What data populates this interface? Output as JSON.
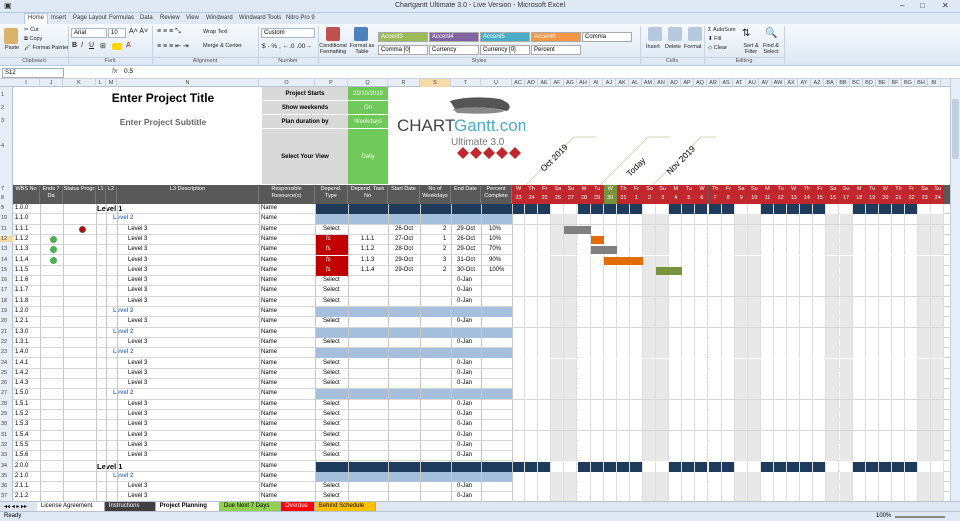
{
  "window": {
    "title": "Chartgantt Ultimate 3.0 - Live Version - Microsoft Excel"
  },
  "ribbon_tabs": [
    "Home",
    "Insert",
    "Page Layout",
    "Formulas",
    "Data",
    "Review",
    "View",
    "Windward",
    "Windward Tools",
    "Nitro Pro 9"
  ],
  "ribbon": {
    "clipboard": {
      "paste": "Paste",
      "cut": "Cut",
      "copy": "Copy",
      "format_painter": "Format Painter",
      "group": "Clipboard"
    },
    "font": {
      "name": "Arial",
      "size": "10",
      "group": "Font"
    },
    "alignment": {
      "wrap": "Wrap Text",
      "merge": "Merge & Center",
      "group": "Alignment"
    },
    "number": {
      "format": "Custom",
      "group": "Number"
    },
    "styles": {
      "cond": "Conditional Formatting",
      "table": "Format as Table",
      "group": "Styles",
      "items": [
        {
          "label": "Accent3",
          "bg": "#9bbb59",
          "fg": "#ffffff"
        },
        {
          "label": "Accent4",
          "bg": "#8064a2",
          "fg": "#ffffff"
        },
        {
          "label": "Accent5",
          "bg": "#4bacc6",
          "fg": "#ffffff"
        },
        {
          "label": "Accent6",
          "bg": "#f79646",
          "fg": "#ffffff"
        },
        {
          "label": "Comma",
          "bg": "#ffffff",
          "fg": "#000000"
        },
        {
          "label": "Comma [0]",
          "bg": "#ffffff",
          "fg": "#000000"
        },
        {
          "label": "Currency",
          "bg": "#ffffff",
          "fg": "#000000"
        },
        {
          "label": "Currency [0]",
          "bg": "#ffffff",
          "fg": "#000000"
        },
        {
          "label": "Percent",
          "bg": "#ffffff",
          "fg": "#000000"
        }
      ]
    },
    "cells": {
      "insert": "Insert",
      "delete": "Delete",
      "format": "Format",
      "group": "Cells"
    },
    "editing": {
      "autosum": "AutoSum",
      "fill": "Fill",
      "clear": "Clear",
      "sort": "Sort & Filter",
      "find": "Find & Select",
      "group": "Editing"
    }
  },
  "formula_bar": {
    "name_box": "S12",
    "fx": "fx",
    "value": "0.5"
  },
  "col_letters": [
    "I",
    "J",
    "K",
    "L",
    "M",
    "N",
    "O",
    "P",
    "Q",
    "R",
    "S",
    "T",
    "U",
    "AC",
    "AD",
    "AE",
    "AF",
    "AG",
    "AH",
    "AI",
    "AJ",
    "AK",
    "AL",
    "AM",
    "AN",
    "AO",
    "AP",
    "AQ",
    "AR",
    "AS",
    "AT",
    "AU",
    "AV",
    "AW",
    "AX",
    "AY",
    "AZ",
    "BA",
    "BB",
    "BC",
    "BD",
    "BE",
    "BF",
    "BG",
    "BH",
    "BI"
  ],
  "row_numbers": [
    "1",
    "2",
    "3",
    "4",
    "7",
    "8",
    "9",
    "10",
    "11",
    "12",
    "13",
    "14",
    "15",
    "16",
    "17",
    "18",
    "19",
    "20",
    "21",
    "22",
    "23",
    "24",
    "25",
    "26",
    "27",
    "28",
    "29",
    "30",
    "31",
    "32",
    "33",
    "34",
    "35",
    "36",
    "37"
  ],
  "project": {
    "title": "Enter Project Title",
    "subtitle": "Enter Project Subtitle"
  },
  "settings": [
    {
      "label": "Project Starts",
      "value": "23/10/2019"
    },
    {
      "label": "Show weekends",
      "value": "On"
    },
    {
      "label": "Plan duration by",
      "value": "Weekdays"
    },
    {
      "label": "Select Your View",
      "value": "Daily"
    }
  ],
  "logo": {
    "brand1": "CHART",
    "brand2": "Gantt",
    "brand3": ".com",
    "sub": "Ultimate 3.0"
  },
  "month_labels": [
    "Oct 2019",
    "Today",
    "Nov 2019"
  ],
  "table_headers": {
    "wbs": "WBS No",
    "ends": "Ends 7 Da",
    "status": "Status Progr",
    "l1": "L1",
    "l2": "L2",
    "l3": "L3 Description",
    "resp": "Responsible Resource(s)",
    "dtype": "Depend. Type",
    "dtask": "Depend. Task No",
    "start": "Start Date",
    "days": "No of Weekdays",
    "end": "End Date",
    "pct": "Percent Complete"
  },
  "day_letters": [
    "W",
    "Th",
    "Fr",
    "Sa",
    "Su",
    "M",
    "Tu",
    "W",
    "Th",
    "Fr",
    "Sa",
    "Su",
    "M",
    "Tu",
    "W",
    "Th",
    "Fr",
    "Sa",
    "Su",
    "M",
    "Tu",
    "W",
    "Th",
    "Fr",
    "Sa",
    "Su",
    "M",
    "Tu",
    "W",
    "Th",
    "Fr",
    "Sa",
    "Su"
  ],
  "day_numbers": [
    "23",
    "24",
    "25",
    "26",
    "27",
    "28",
    "29",
    "30",
    "31",
    "1",
    "2",
    "3",
    "4",
    "5",
    "6",
    "7",
    "8",
    "9",
    "10",
    "11",
    "12",
    "13",
    "14",
    "15",
    "16",
    "17",
    "18",
    "19",
    "20",
    "21",
    "22",
    "23",
    "24"
  ],
  "rows": [
    {
      "wbs": "1.0.0",
      "l1": "Level 1",
      "resp": "Name",
      "type": "L1"
    },
    {
      "wbs": "1.1.0",
      "l2": "Level 2",
      "resp": "Name",
      "type": "L2"
    },
    {
      "wbs": "1.1.1",
      "l3": "Level 3",
      "resp": "Name",
      "dtype": "Select",
      "start": "26-Oct",
      "days": "2",
      "end": "29-Oct",
      "pct": "10%",
      "status": "red"
    },
    {
      "wbs": "1.1.2",
      "l3": "Level 3",
      "resp": "Name",
      "dtype": "fs",
      "dtask": "1.1.1",
      "start": "27-Oct",
      "days": "1",
      "end": "26-Oct",
      "pct": "10%",
      "ends": "ok"
    },
    {
      "wbs": "1.1.3",
      "l3": "Level 3",
      "resp": "Name",
      "dtype": "fs",
      "dtask": "1.1.2",
      "start": "28-Oct",
      "days": "2",
      "end": "29-Oct",
      "pct": "70%",
      "ends": "ok"
    },
    {
      "wbs": "1.1.4",
      "l3": "Level 3",
      "resp": "Name",
      "dtype": "fs",
      "dtask": "1.1.3",
      "start": "29-Oct",
      "days": "3",
      "end": "31-Oct",
      "pct": "90%",
      "ends": "ok"
    },
    {
      "wbs": "1.1.5",
      "l3": "Level 3",
      "resp": "Name",
      "dtype": "fs",
      "dtask": "1.1.4",
      "start": "29-Oct",
      "days": "2",
      "end": "30-Oct",
      "pct": "100%"
    },
    {
      "wbs": "1.1.6",
      "l3": "Level 3",
      "resp": "Name",
      "dtype": "Select",
      "end": "0-Jan"
    },
    {
      "wbs": "1.1.7",
      "l3": "Level 3",
      "resp": "Name",
      "dtype": "Select",
      "end": "0-Jan"
    },
    {
      "wbs": "1.1.8",
      "l3": "Level 3",
      "resp": "Name",
      "dtype": "Select",
      "end": "0-Jan"
    },
    {
      "wbs": "1.2.0",
      "l2": "Level 2",
      "resp": "Name",
      "type": "L2"
    },
    {
      "wbs": "1.2.1",
      "l3": "Level 3",
      "resp": "Name",
      "dtype": "Select",
      "end": "0-Jan"
    },
    {
      "wbs": "1.3.0",
      "l2": "Level 2",
      "resp": "Name",
      "type": "L2"
    },
    {
      "wbs": "1.3.1",
      "l3": "Level 3",
      "resp": "Name",
      "dtype": "Select",
      "end": "0-Jan"
    },
    {
      "wbs": "1.4.0",
      "l2": "Level 2",
      "resp": "Name",
      "type": "L2"
    },
    {
      "wbs": "1.4.1",
      "l3": "Level 3",
      "resp": "Name",
      "dtype": "Select",
      "end": "0-Jan"
    },
    {
      "wbs": "1.4.2",
      "l3": "Level 3",
      "resp": "Name",
      "dtype": "Select",
      "end": "0-Jan"
    },
    {
      "wbs": "1.4.3",
      "l3": "Level 3",
      "resp": "Name",
      "dtype": "Select",
      "end": "0-Jan"
    },
    {
      "wbs": "1.5.0",
      "l2": "Level 2",
      "resp": "Name",
      "type": "L2"
    },
    {
      "wbs": "1.5.1",
      "l3": "Level 3",
      "resp": "Name",
      "dtype": "Select",
      "end": "0-Jan"
    },
    {
      "wbs": "1.5.2",
      "l3": "Level 3",
      "resp": "Name",
      "dtype": "Select",
      "end": "0-Jan"
    },
    {
      "wbs": "1.5.3",
      "l3": "Level 3",
      "resp": "Name",
      "dtype": "Select",
      "end": "0-Jan"
    },
    {
      "wbs": "1.5.4",
      "l3": "Level 3",
      "resp": "Name",
      "dtype": "Select",
      "end": "0-Jan"
    },
    {
      "wbs": "1.5.5",
      "l3": "Level 3",
      "resp": "Name",
      "dtype": "Select",
      "end": "0-Jan"
    },
    {
      "wbs": "1.5.6",
      "l3": "Level 3",
      "resp": "Name",
      "dtype": "Select",
      "end": "0-Jan"
    },
    {
      "wbs": "2.0.0",
      "l1": "Level 1",
      "resp": "Name",
      "type": "L1"
    },
    {
      "wbs": "2.1.0",
      "l2": "Level 2",
      "resp": "Name",
      "type": "L2"
    },
    {
      "wbs": "2.1.1",
      "l3": "Level 3",
      "resp": "Name",
      "dtype": "Select",
      "end": "0-Jan"
    },
    {
      "wbs": "2.1.2",
      "l3": "Level 3",
      "resp": "Name",
      "dtype": "Select",
      "end": "0-Jan"
    }
  ],
  "gantt_bars": [
    {
      "row": 2,
      "start": 4,
      "len": 2,
      "color": "#808080"
    },
    {
      "row": 3,
      "start": 6,
      "len": 1,
      "color": "#e36c09"
    },
    {
      "row": 4,
      "start": 6,
      "len": 2,
      "color": "#808080"
    },
    {
      "row": 5,
      "start": 7,
      "len": 3,
      "color": "#e36c09"
    },
    {
      "row": 6,
      "start": 11,
      "len": 2,
      "color": "#77933c"
    }
  ],
  "sheet_tabs": [
    {
      "label": "License Agreement",
      "bg": "#ffffff",
      "fg": "#000"
    },
    {
      "label": "Instructions",
      "bg": "#404040",
      "fg": "#fff"
    },
    {
      "label": "Project Planning",
      "bg": "#ffffff",
      "fg": "#000",
      "active": true
    },
    {
      "label": "Due Next 7 Days",
      "bg": "#92d050",
      "fg": "#000"
    },
    {
      "label": "Overdue",
      "bg": "#ff0000",
      "fg": "#fff"
    },
    {
      "label": "Behind Schedule",
      "bg": "#ffc000",
      "fg": "#000"
    }
  ],
  "status_bar": {
    "left": "Ready",
    "zoom": "100%"
  }
}
